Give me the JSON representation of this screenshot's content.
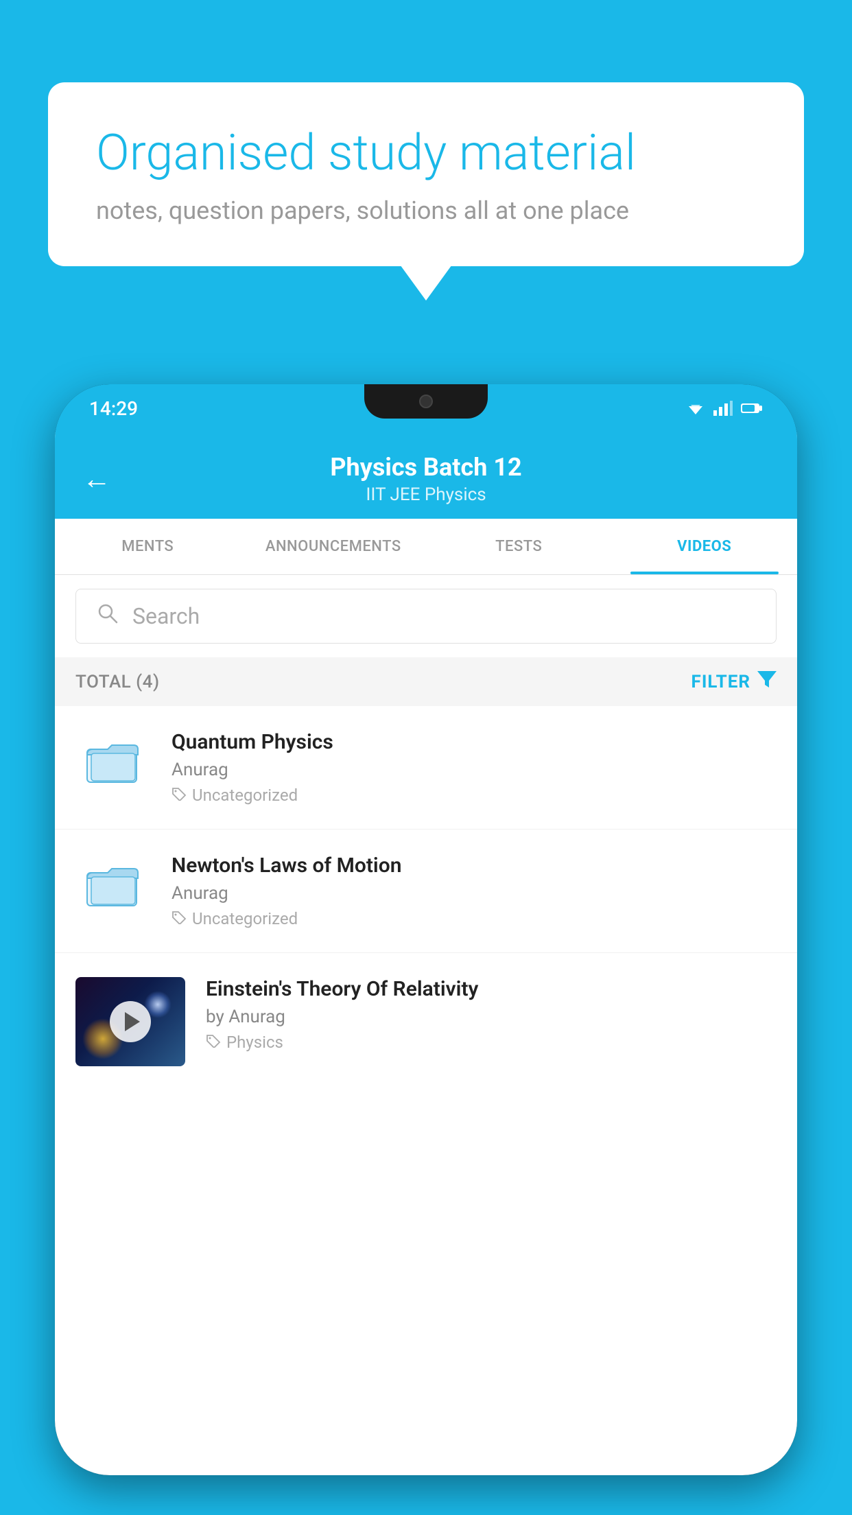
{
  "background_color": "#1ab8e8",
  "speech_bubble": {
    "title": "Organised study material",
    "subtitle": "notes, question papers, solutions all at one place"
  },
  "status_bar": {
    "time": "14:29",
    "wifi": "▼",
    "signal": "▲",
    "battery": "▌"
  },
  "app_header": {
    "back_label": "←",
    "title": "Physics Batch 12",
    "subtitle": "IIT JEE   Physics"
  },
  "tabs": [
    {
      "label": "MENTS",
      "active": false
    },
    {
      "label": "ANNOUNCEMENTS",
      "active": false
    },
    {
      "label": "TESTS",
      "active": false
    },
    {
      "label": "VIDEOS",
      "active": true
    }
  ],
  "search": {
    "placeholder": "Search"
  },
  "filter_bar": {
    "total_label": "TOTAL (4)",
    "filter_label": "FILTER"
  },
  "videos": [
    {
      "type": "folder",
      "title": "Quantum Physics",
      "author": "Anurag",
      "tag": "Uncategorized"
    },
    {
      "type": "folder",
      "title": "Newton's Laws of Motion",
      "author": "Anurag",
      "tag": "Uncategorized"
    },
    {
      "type": "video",
      "title": "Einstein's Theory Of Relativity",
      "author": "by Anurag",
      "tag": "Physics"
    }
  ]
}
